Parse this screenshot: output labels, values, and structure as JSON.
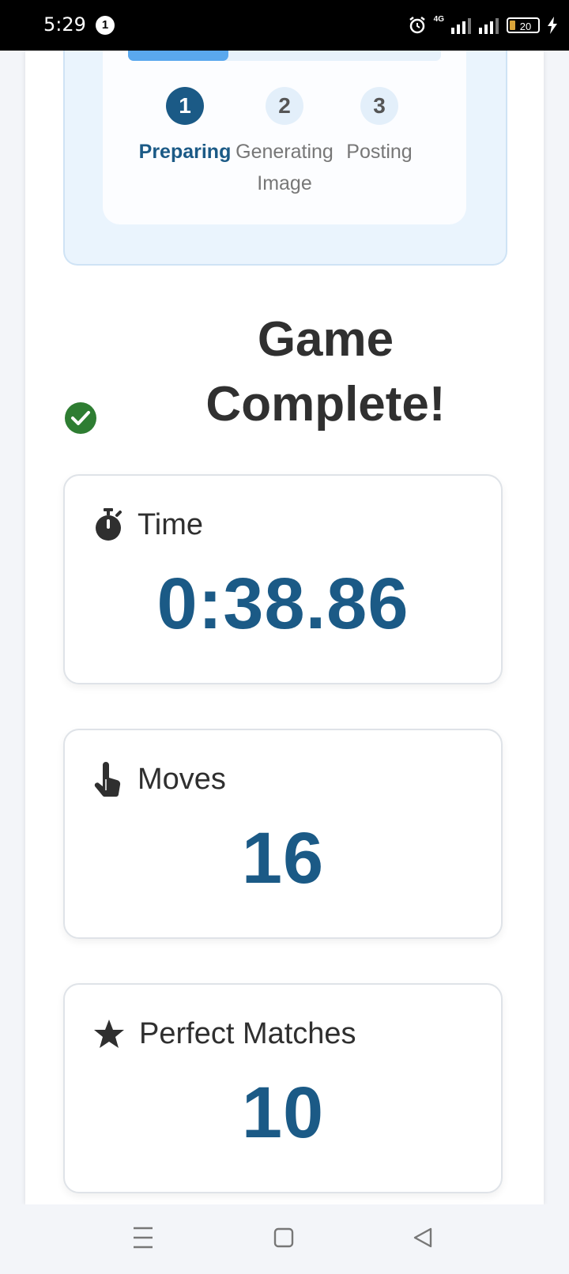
{
  "status_bar": {
    "time": "5:29",
    "notification_count": "1",
    "network": "4G",
    "battery_level": "20"
  },
  "progress": {
    "fill_fraction": 0.32,
    "steps": [
      {
        "number": "1",
        "label": "Preparing",
        "active": true
      },
      {
        "number": "2",
        "label": "Generating Image",
        "active": false
      },
      {
        "number": "3",
        "label": "Posting",
        "active": false
      }
    ]
  },
  "result": {
    "title": "Game Complete!",
    "icon": "check-circle-icon"
  },
  "stats": [
    {
      "label": "Time",
      "value": "0:38.86",
      "icon": "stopwatch-icon"
    },
    {
      "label": "Moves",
      "value": "16",
      "icon": "pointer-hand-icon"
    },
    {
      "label": "Perfect Matches",
      "value": "10",
      "icon": "star-icon"
    }
  ],
  "colors": {
    "accent": "#1b5a86",
    "success": "#2e7d32",
    "progress_fill": "#5aa8ee"
  }
}
